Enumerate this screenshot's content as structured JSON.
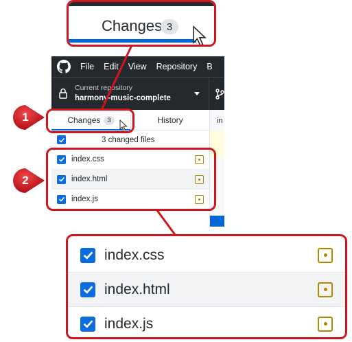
{
  "menubar": {
    "items": [
      "File",
      "Edit",
      "View",
      "Repository",
      "B"
    ]
  },
  "repo": {
    "label": "Current repository",
    "name": "harmony-music-complete"
  },
  "tabs": {
    "changes_label": "Changes",
    "changes_count": "3",
    "history_label": "History"
  },
  "file_list": {
    "header": "3 changed files",
    "files": [
      "index.css",
      "index.html",
      "index.js"
    ]
  },
  "diff_pane": {
    "fragment": "in"
  },
  "steps": [
    "1",
    "2"
  ],
  "icons": {
    "logo": "github-logo-icon",
    "lock": "lock-icon",
    "branch": "branch-icon",
    "caret": "caret-down-icon",
    "checkbox": "checkbox-checked-icon",
    "modified": "file-modified-icon",
    "cursor": "mouse-cursor-icon"
  },
  "colors": {
    "titlebar": "#24292e",
    "accent": "#0366d6",
    "checkbox": "#0b6ce0",
    "modified": "#b08800",
    "callout": "#d0151e"
  }
}
